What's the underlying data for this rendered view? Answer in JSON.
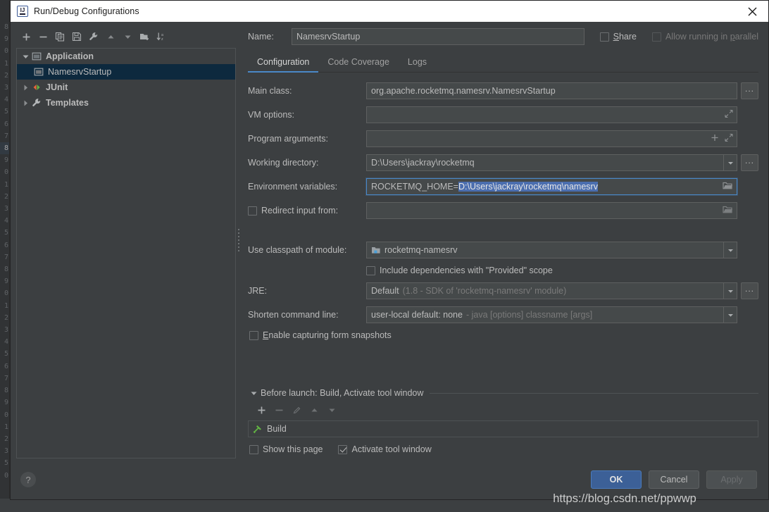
{
  "window": {
    "title": "Run/Debug Configurations",
    "app_icon": "intellij-idea-icon",
    "close_icon": "close-icon"
  },
  "tree_toolbar": {
    "buttons": [
      {
        "name": "add-configuration-button",
        "icon": "plus-icon"
      },
      {
        "name": "remove-configuration-button",
        "icon": "minus-icon"
      },
      {
        "name": "copy-configuration-button",
        "icon": "copy-icon"
      },
      {
        "name": "save-configuration-button",
        "icon": "save-icon"
      },
      {
        "name": "edit-templates-button",
        "icon": "wrench-icon"
      },
      {
        "name": "move-up-button",
        "icon": "arrow-up-icon"
      },
      {
        "name": "move-down-button",
        "icon": "arrow-down-icon"
      },
      {
        "name": "create-folder-button",
        "icon": "folder-add-icon"
      },
      {
        "name": "sort-configurations-button",
        "icon": "sort-az-icon"
      }
    ]
  },
  "tree": {
    "items": [
      {
        "label": "Application",
        "icon": "application-icon",
        "expanded": true,
        "level": 0,
        "selected": false,
        "bold": true
      },
      {
        "label": "NamesrvStartup",
        "icon": "application-icon",
        "level": 1,
        "selected": true,
        "bold": false
      },
      {
        "label": "JUnit",
        "icon": "junit-icon",
        "expanded": false,
        "level": 0,
        "selected": false,
        "bold": true
      },
      {
        "label": "Templates",
        "icon": "wrench-icon",
        "expanded": false,
        "level": 0,
        "selected": false,
        "bold": true
      }
    ]
  },
  "name_row": {
    "label": "Name:",
    "value": "NamesrvStartup",
    "share": {
      "label_before": "",
      "mnemonic": "S",
      "label_after": "hare",
      "checked": false,
      "enabled": true
    },
    "allow_parallel": {
      "label_before": "Allow running in ",
      "mnemonic": "p",
      "label_after": "arallel",
      "checked": false,
      "enabled": false
    }
  },
  "tabs": [
    {
      "label": "Configuration",
      "active": true
    },
    {
      "label": "Code Coverage",
      "active": false
    },
    {
      "label": "Logs",
      "active": false
    }
  ],
  "form": {
    "main_class": {
      "label": "Main class:",
      "value": "org.apache.rocketmq.namesrv.NamesrvStartup",
      "browse_label": "...",
      "browse_icon": "ellipsis-icon"
    },
    "vm_options": {
      "label": "VM options:",
      "value": "",
      "expand_icon": "expand-diagonal-icon"
    },
    "program_arguments": {
      "label": "Program arguments:",
      "value": "",
      "add_icon": "plus-icon",
      "expand_icon": "expand-diagonal-icon"
    },
    "working_directory": {
      "label": "Working directory:",
      "value": "D:\\Users\\jackray\\rocketmq",
      "dropdown_icon": "chevron-down-icon",
      "browse_label": "...",
      "browse_icon": "ellipsis-icon"
    },
    "environment_variables": {
      "label": "Environment variables:",
      "value_plain": "ROCKETMQ_HOME=",
      "value_selected": "D:\\Users\\jackray\\rocketmq\\namesrv",
      "focused": true,
      "browse_icon": "folder-icon"
    },
    "redirect_input": {
      "label": "Redirect input from:",
      "checked": false,
      "value": "",
      "browse_icon": "folder-icon"
    },
    "use_classpath_of_module": {
      "label": "Use classpath of module:",
      "value": "rocketmq-namesrv",
      "value_icon": "module-icon",
      "dropdown_icon": "chevron-down-icon"
    },
    "include_provided": {
      "label": "Include dependencies with \"Provided\" scope",
      "checked": false
    },
    "jre": {
      "label": "JRE:",
      "value_bright": "Default",
      "value_dim": "(1.8 - SDK of 'rocketmq-namesrv' module)",
      "dropdown_icon": "chevron-down-icon",
      "browse_label": "...",
      "browse_icon": "ellipsis-icon"
    },
    "shorten_command_line": {
      "label": "Shorten command line:",
      "value_bright": "user-local default: none",
      "value_dim": "- java [options] classname [args]",
      "dropdown_icon": "chevron-down-icon"
    },
    "enable_capturing": {
      "label_before": "",
      "mnemonic": "E",
      "label_after": "nable capturing form snapshots",
      "checked": false
    }
  },
  "before_launch": {
    "header": "Before launch: Build, Activate tool window",
    "collapse_icon": "triangle-down-icon",
    "toolbar": [
      {
        "name": "add-task-button",
        "icon": "plus-icon",
        "enabled": true
      },
      {
        "name": "remove-task-button",
        "icon": "minus-icon",
        "enabled": false
      },
      {
        "name": "edit-task-button",
        "icon": "pencil-icon",
        "enabled": false
      },
      {
        "name": "task-move-up-button",
        "icon": "arrow-up-icon",
        "enabled": false
      },
      {
        "name": "task-move-down-button",
        "icon": "arrow-down-icon",
        "enabled": false
      }
    ],
    "tasks": [
      {
        "label": "Build",
        "icon": "build-hammer-icon"
      }
    ],
    "show_this_page": {
      "label": "Show this page",
      "checked": false
    },
    "activate_tool_window": {
      "label": "Activate tool window",
      "checked": true
    }
  },
  "footer": {
    "help_label": "?",
    "help_icon": "help-icon",
    "ok": {
      "label": "OK",
      "primary": true,
      "enabled": true
    },
    "cancel": {
      "label": "Cancel",
      "primary": false,
      "enabled": true
    },
    "apply": {
      "label": "Apply",
      "primary": false,
      "enabled": false
    }
  },
  "watermark": {
    "text": "https://blog.csdn.net/ppwwp"
  },
  "background_editor": {
    "gutter_lines": [
      "8",
      "9",
      "0",
      "1",
      "2",
      "3",
      "4",
      "5",
      "6",
      "7",
      "8",
      "9",
      "0",
      "1",
      "2",
      "3",
      "4",
      "5",
      "6",
      "7",
      "8",
      "9",
      "0",
      "1",
      "2",
      "3",
      "4",
      "5",
      "6",
      "7",
      "8",
      "9",
      "0",
      "1",
      "2",
      "3",
      "5",
      "0"
    ],
    "highlight_index": 10
  },
  "colors": {
    "dialog_bg": "#3c3f41",
    "field_bg": "#45494a",
    "text": "#bbbbbb",
    "text_dim": "#7a7a7a",
    "accent": "#4a88c7",
    "selection": "#4b6eaf",
    "tree_selection": "#0d293e",
    "primary_button": "#3c6097",
    "build_icon": "#62b543",
    "junit_icon_orange": "#e8663a"
  }
}
